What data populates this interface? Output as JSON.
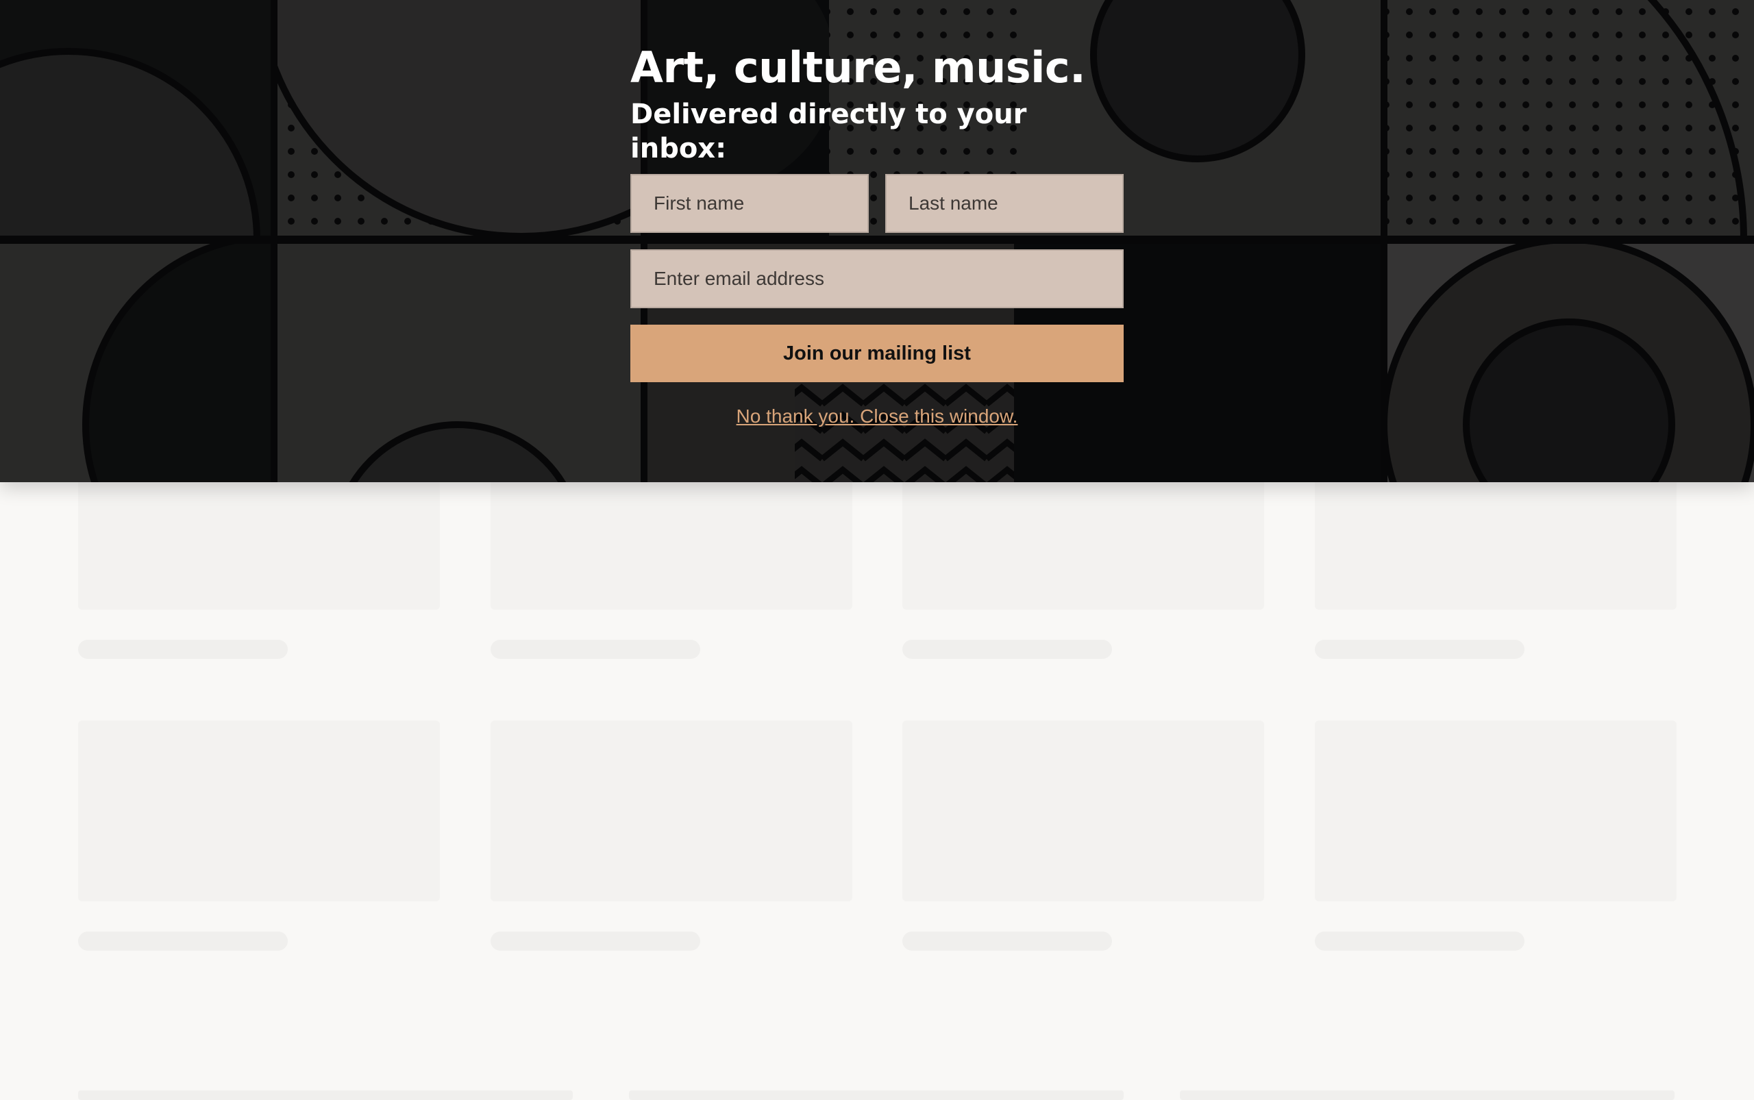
{
  "newsletter": {
    "headline": "Art, culture, music.",
    "subheadline": "Delivered directly to your inbox:",
    "first_name_placeholder": "First name",
    "last_name_placeholder": "Last name",
    "email_placeholder": "Enter email address",
    "join_button_label": "Join our mailing list",
    "close_link_label": "No thank you. Close this window."
  },
  "colors": {
    "banner_background": "#0d0e10",
    "input_background": "#d4c3b8",
    "accent": "#d9a57a",
    "page_background": "#f9f8f6",
    "skeleton": "#f3f2f0"
  }
}
